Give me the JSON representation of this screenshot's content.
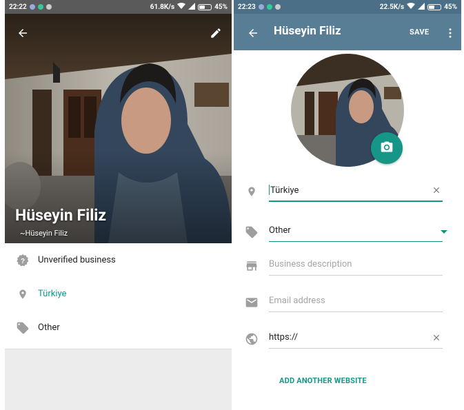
{
  "left": {
    "status": {
      "time": "22:22",
      "speed": "61.8K/s",
      "battery": "45%"
    },
    "name": "Hüseyin Filiz",
    "push_name": "~Hüseyin Filiz",
    "items": [
      {
        "label": "Unverified business",
        "icon": "question-badge-icon",
        "accent": false
      },
      {
        "label": "Türkiye",
        "icon": "location-pin-icon",
        "accent": true
      },
      {
        "label": "Other",
        "icon": "tag-icon",
        "accent": false
      }
    ]
  },
  "right": {
    "status": {
      "time": "22:23",
      "speed": "22.5K/s",
      "battery": "45%"
    },
    "appbar": {
      "title": "Hüseyin Filiz",
      "save": "SAVE"
    },
    "fields": {
      "location": {
        "value": "Türkiye"
      },
      "category": {
        "value": "Other"
      },
      "description": {
        "placeholder": "Business description"
      },
      "email": {
        "placeholder": "Email address"
      },
      "website": {
        "value": "https://"
      }
    },
    "add_website": "ADD ANOTHER WEBSITE"
  },
  "colors": {
    "teal": "#159687",
    "appbar": "#587e96",
    "statusbar": "#4b6f86"
  }
}
